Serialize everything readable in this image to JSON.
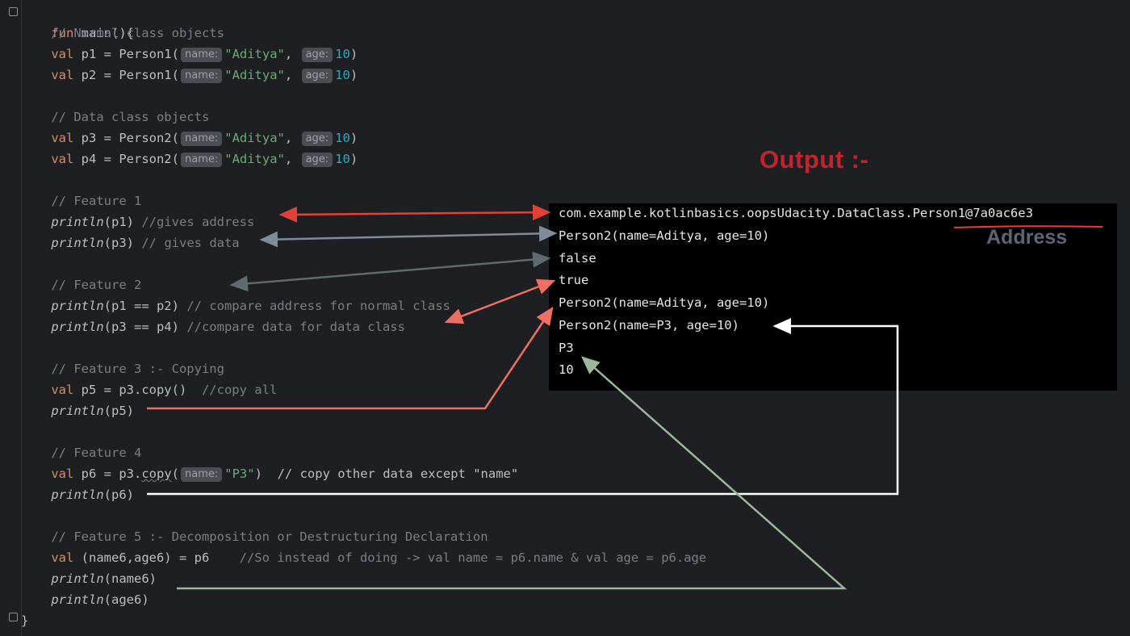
{
  "code": {
    "lines": [
      {
        "text": "fun main(){"
      },
      {
        "text": "    // Normal class objects"
      },
      {
        "text": "    val p1 = Person1(",
        "hint1": "name:",
        "str1": "\"Aditya\"",
        "hint2": "age:",
        "num": "10",
        "end": ")"
      },
      {
        "text": "    val p2 = Person1(",
        "hint1": "name:",
        "str1": "\"Aditya\"",
        "hint2": "age:",
        "num": "10",
        "end": ")"
      },
      {
        "text": ""
      },
      {
        "text": "    // Data class objects"
      },
      {
        "text": "    val p3 = Person2(",
        "hint1": "name:",
        "str1": "\"Aditya\"",
        "hint2": "age:",
        "num": "10",
        "end": ")"
      },
      {
        "text": "    val p4 = Person2(",
        "hint1": "name:",
        "str1": "\"Aditya\"",
        "hint2": "age:",
        "num": "10",
        "end": ")"
      },
      {
        "text": ""
      },
      {
        "text": "    // Feature 1"
      },
      {
        "text": "    println(p1) //gives address"
      },
      {
        "text": "    println(p3) // gives data"
      },
      {
        "text": ""
      },
      {
        "text": "    // Feature 2"
      },
      {
        "text": "    println(p1 == p2) // compare address for normal class"
      },
      {
        "text": "    println(p3 == p4) //compare data for data class"
      },
      {
        "text": ""
      },
      {
        "text": "    // Feature 3 :- Copying"
      },
      {
        "text": "    val p5 = p3.copy()  //copy all"
      },
      {
        "text": "    println(p5)"
      },
      {
        "text": ""
      },
      {
        "text": "    // Feature 4"
      },
      {
        "text": "    val p6 = p3.copy(",
        "hint1": "name:",
        "str1": "\"P3\"",
        "end": ")  // copy other data except \"name\""
      },
      {
        "text": "    println(p6)"
      },
      {
        "text": ""
      },
      {
        "text": "    // Feature 5 :- Decomposition or Destructuring Declaration"
      },
      {
        "text": "    val (name6,age6) = p6    //So instead of doing -> val name = p6.name & val age = p6.age"
      },
      {
        "text": "    println(name6)"
      },
      {
        "text": "    println(age6)"
      },
      {
        "text": "}"
      }
    ]
  },
  "output": {
    "title": "Output :-",
    "lines": [
      "com.example.kotlinbasics.oopsUdacity.DataClass.Person1@7a0ac6e3",
      "Person2(name=Aditya, age=10)",
      "false",
      "true",
      "Person2(name=Aditya, age=10)",
      "Person2(name=P3, age=10)",
      "P3",
      "10"
    ],
    "address_label": "Address"
  },
  "colors": {
    "red_arrow": "#e0413a",
    "gray_arrow": "#7f8c9a",
    "dark_arrow": "#5f6b6f",
    "salmon_arrow": "#ef6f62",
    "white_arrow": "#ffffff",
    "green_arrow": "#9cb89a"
  }
}
